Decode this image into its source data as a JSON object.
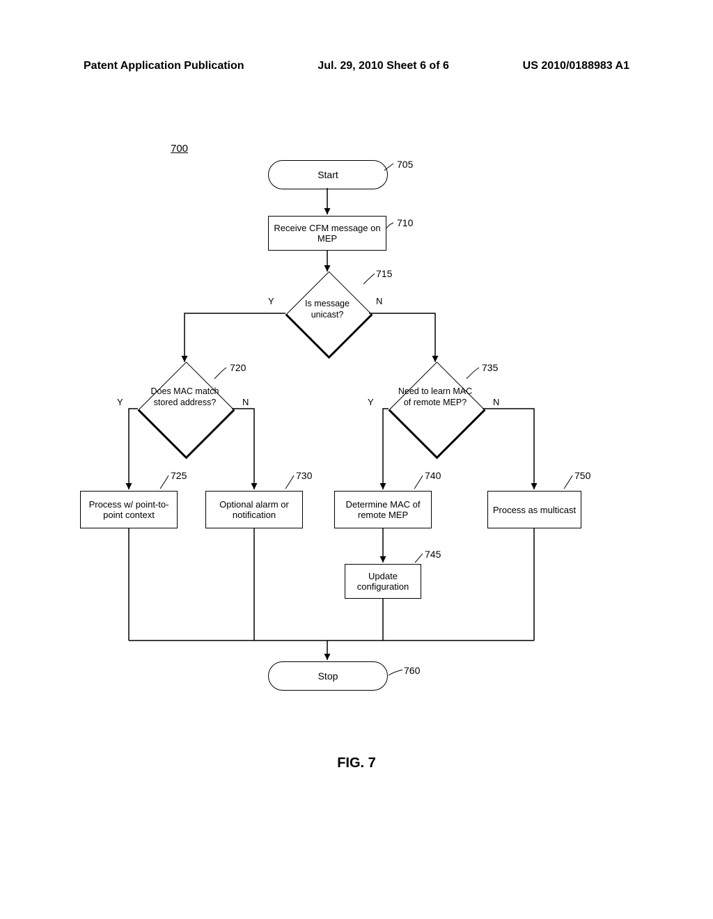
{
  "header": {
    "left": "Patent Application Publication",
    "center": "Jul. 29, 2010  Sheet 6 of 6",
    "right": "US 2010/0188983 A1"
  },
  "figure_ref": "700",
  "figure_caption": "FIG. 7",
  "nodes": {
    "n705": {
      "label": "Start",
      "ref": "705"
    },
    "n710": {
      "label": "Receive CFM message on MEP",
      "ref": "710"
    },
    "n715": {
      "label": "Is message unicast?",
      "ref": "715"
    },
    "n720": {
      "label": "Does MAC match stored address?",
      "ref": "720"
    },
    "n725": {
      "label": "Process w/ point-to-point context",
      "ref": "725"
    },
    "n730": {
      "label": "Optional alarm or notification",
      "ref": "730"
    },
    "n735": {
      "label": "Need to learn MAC of remote MEP?",
      "ref": "735"
    },
    "n740": {
      "label": "Determine MAC of remote MEP",
      "ref": "740"
    },
    "n745": {
      "label": "Update configuration",
      "ref": "745"
    },
    "n750": {
      "label": "Process as multicast",
      "ref": "750"
    },
    "n760": {
      "label": "Stop",
      "ref": "760"
    }
  },
  "edge_labels": {
    "y": "Y",
    "n": "N"
  }
}
